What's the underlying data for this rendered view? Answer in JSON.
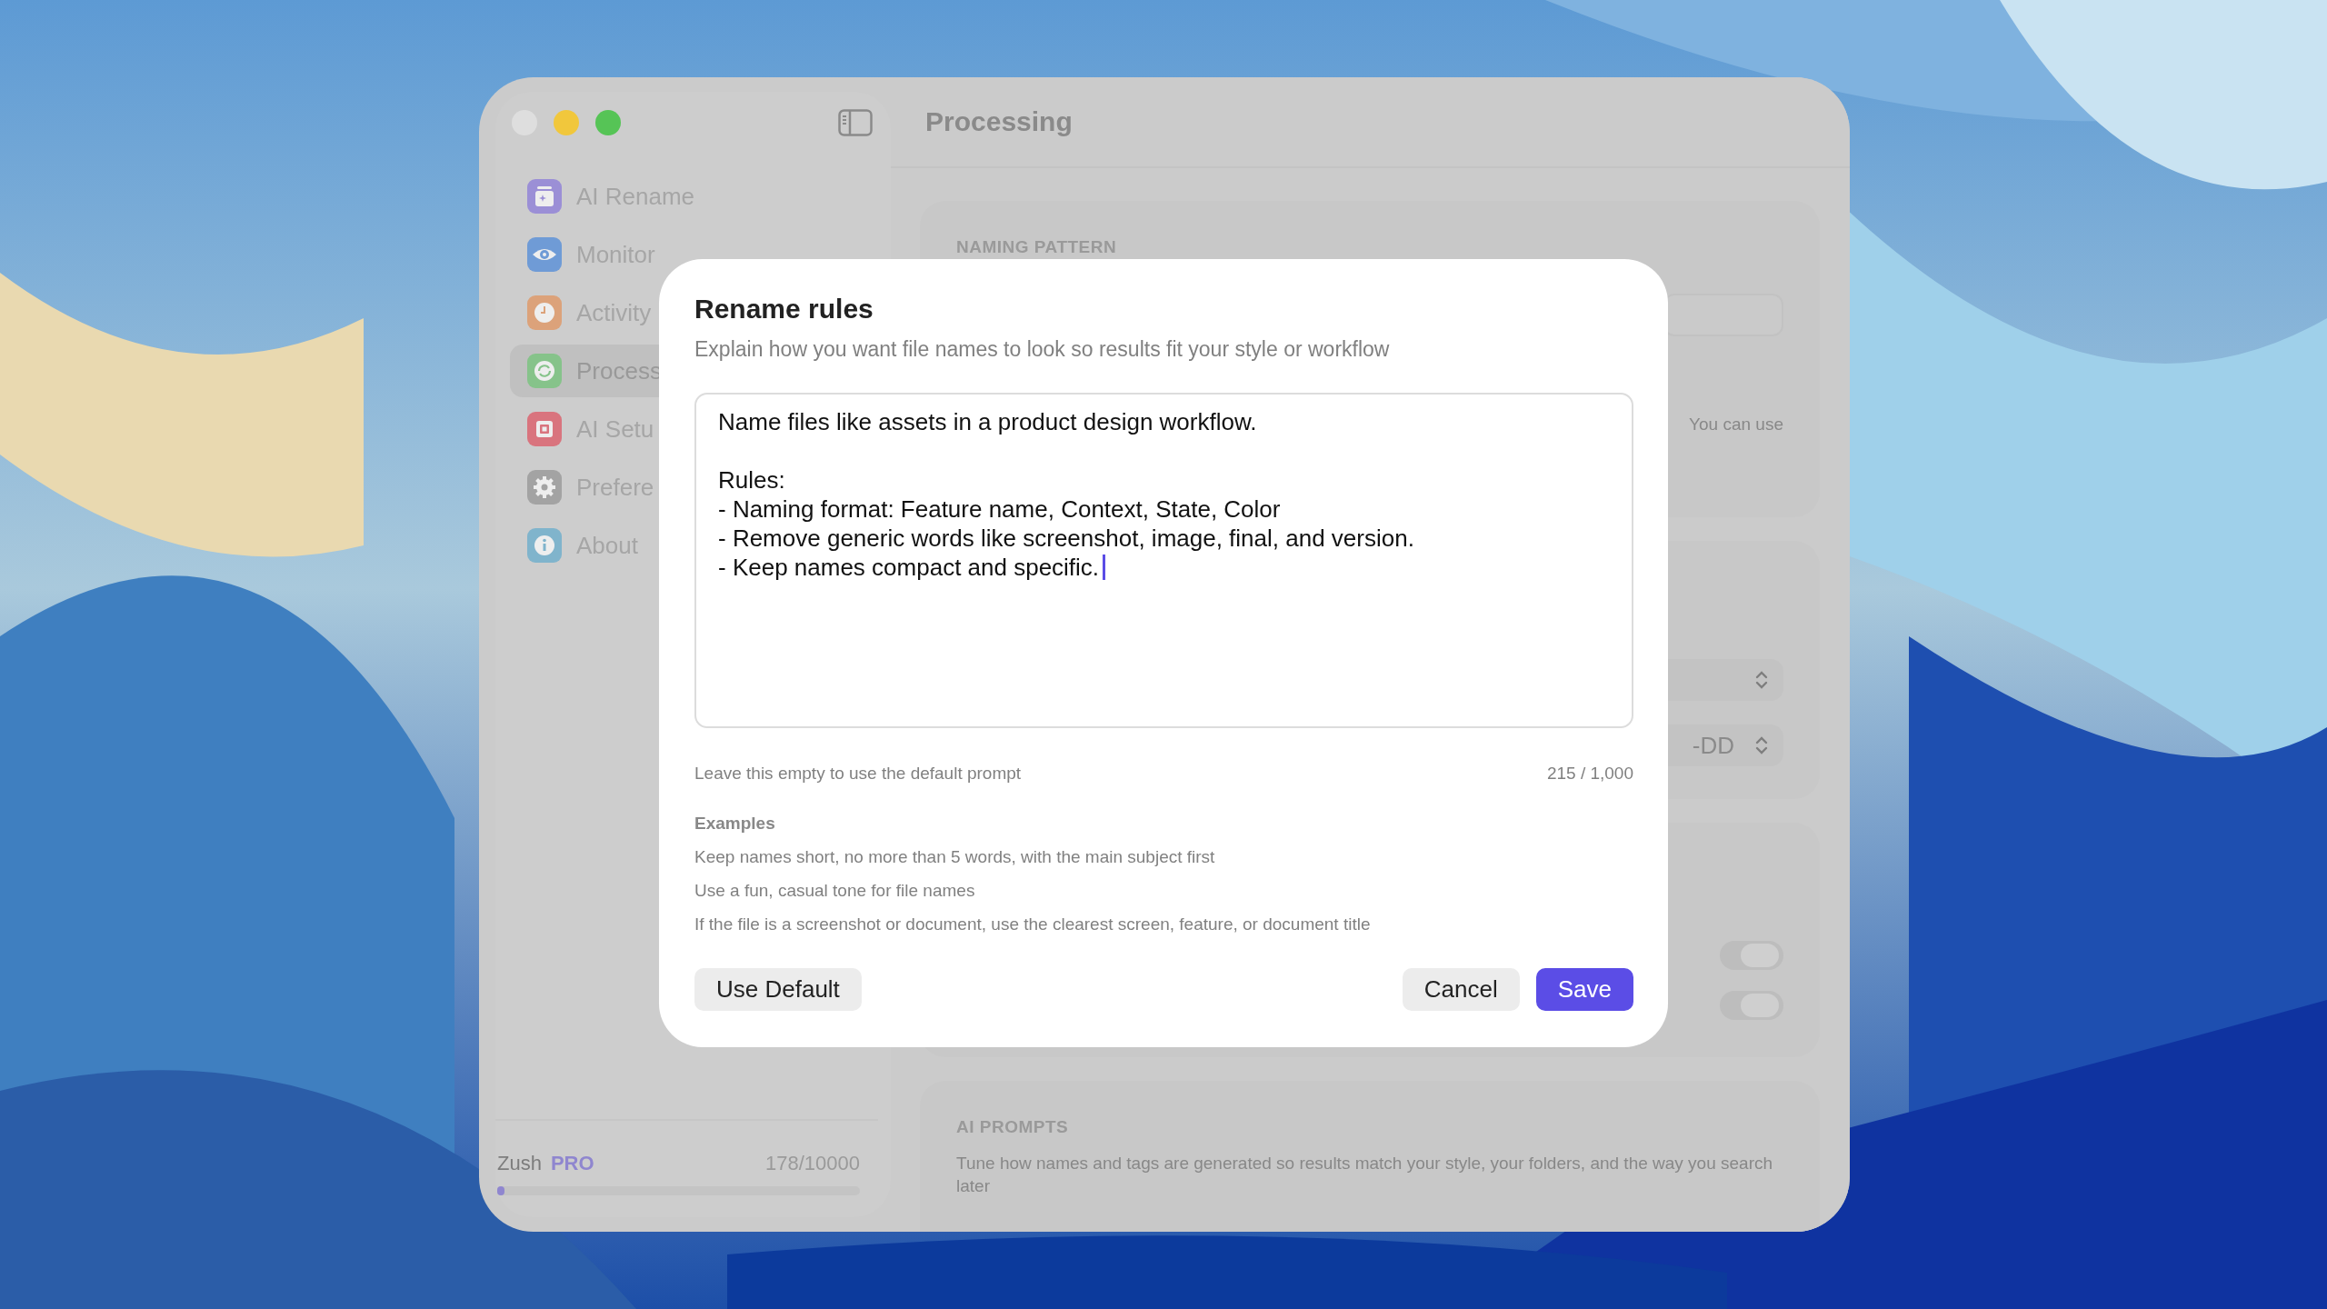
{
  "sidebar": {
    "items": [
      {
        "label": "AI Rename",
        "selected": false
      },
      {
        "label": "Monitor",
        "selected": false
      },
      {
        "label": "Activity",
        "selected": false
      },
      {
        "label": "Process",
        "selected": true
      },
      {
        "label": "AI Setu",
        "selected": false
      },
      {
        "label": "Prefere",
        "selected": false
      },
      {
        "label": "About",
        "selected": false
      }
    ],
    "plan": {
      "app": "Zush",
      "tier": "PRO",
      "usage": "178/10000",
      "level": 0.018
    }
  },
  "content": {
    "title": "Processing",
    "naming_pattern": {
      "heading": "NAMING PATTERN",
      "hint": "You can use"
    },
    "selects": [
      {
        "expanded": false
      },
      {
        "expanded": false,
        "value": "-DD"
      }
    ],
    "toggles": [
      {
        "on": false
      },
      {
        "on": false
      }
    ],
    "ai_prompts": {
      "heading": "AI PROMPTS",
      "description": "Tune how names and tags are generated so results match your style, your folders, and the way you search later"
    }
  },
  "dialog": {
    "title": "Rename rules",
    "subtitle": "Explain how you want file names to look so results fit your style or workflow",
    "field": {
      "value": "Name files like assets in a product design workflow.\n\nRules:\n- Naming format: Feature name, Context, State, Color\n- Remove generic words like screenshot, image, final, and version.\n- Keep names compact and specific.",
      "focused": true
    },
    "hint": "Leave this empty to use the default prompt",
    "count": "215 / 1,000",
    "examples_heading": "Examples",
    "examples": [
      "Keep names short, no more than 5 words, with the main subject first",
      "Use a fun, casual tone for file names",
      "If the file is a screenshot or document, use the clearest screen, feature, or document title"
    ],
    "buttons": [
      {
        "label": "Use Default",
        "kind": "secondary"
      },
      {
        "label": "Cancel",
        "kind": "secondary"
      },
      {
        "label": "Save",
        "kind": "primary"
      }
    ]
  }
}
